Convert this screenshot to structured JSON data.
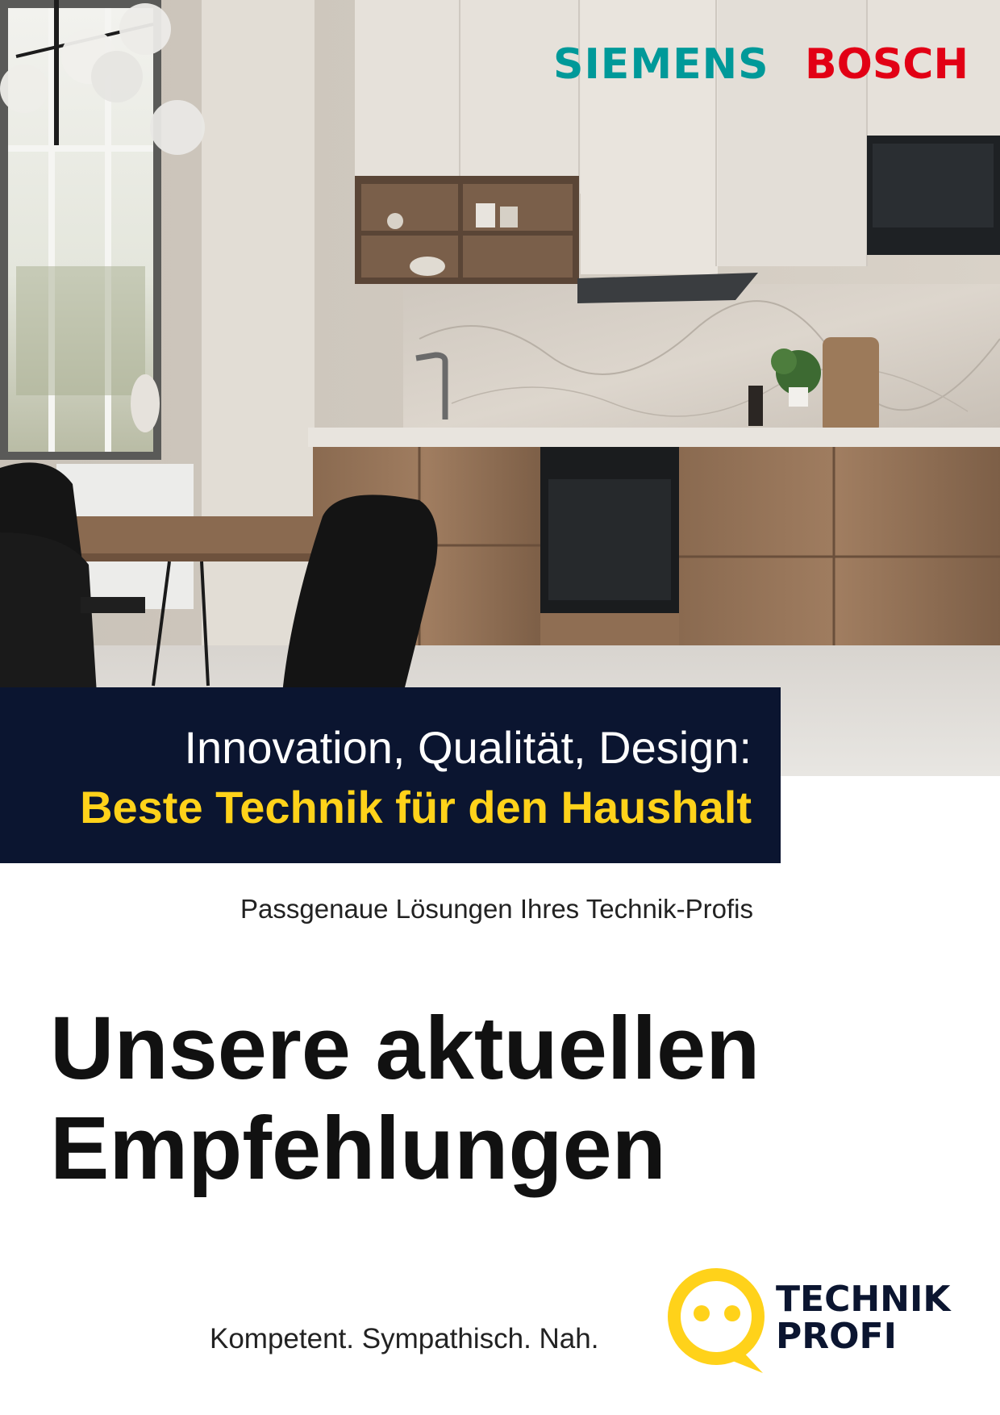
{
  "brands": {
    "left": "SIEMENS",
    "right": "BOSCH",
    "left_color": "#009999",
    "right_color": "#e20015"
  },
  "headline": {
    "line1": "Innovation, Qualität, Design:",
    "line2": "Beste Technik für den Haushalt",
    "box_color": "#0b1530",
    "accent_color": "#ffd21a"
  },
  "subline": "Passgenaue Lösungen Ihres Technik-Profis",
  "title": {
    "line1": "Unsere aktuellen",
    "line2": "Empfehlungen"
  },
  "tagline": "Kompetent. Sympathisch. Nah.",
  "logo": {
    "word1": "TECHNIK",
    "word2": "PROFI",
    "icon": "smiley-speech-bubble-icon"
  },
  "hero_image": {
    "icon": "kitchen-photo"
  }
}
